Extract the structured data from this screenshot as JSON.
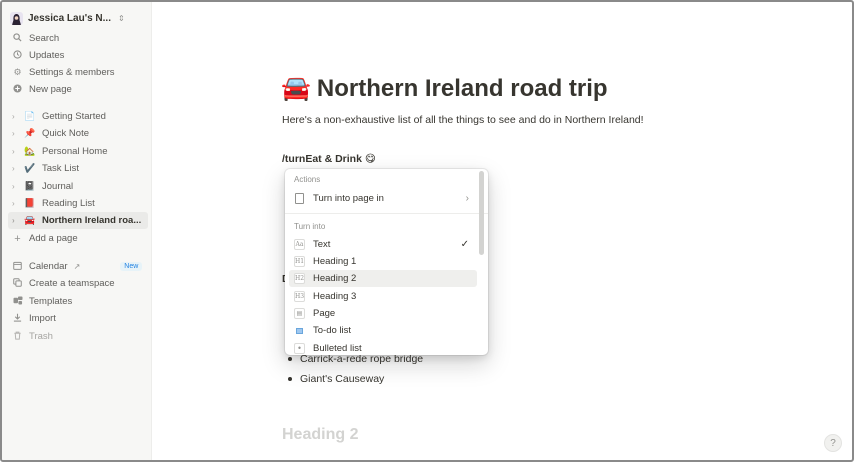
{
  "workspace": {
    "name": "Jessica Lau's N..."
  },
  "sidebar": {
    "top_items": [
      {
        "label": "Search",
        "icon": "search-icon"
      },
      {
        "label": "Updates",
        "icon": "clock-icon"
      },
      {
        "label": "Settings & members",
        "icon": "gear-icon"
      },
      {
        "label": "New page",
        "icon": "plus-circle-icon"
      }
    ],
    "pages": [
      {
        "emoji": "📄",
        "label": "Getting Started"
      },
      {
        "emoji": "📌",
        "label": "Quick Note"
      },
      {
        "emoji": "🏡",
        "label": "Personal Home"
      },
      {
        "emoji": "✔️",
        "label": "Task List"
      },
      {
        "emoji": "📓",
        "label": "Journal"
      },
      {
        "emoji": "📕",
        "label": "Reading List"
      },
      {
        "emoji": "🚘",
        "label": "Northern Ireland roa..."
      }
    ],
    "add_page": "Add a page",
    "bottom_items": [
      {
        "label": "Calendar",
        "icon": "calendar-icon",
        "badge": "New"
      },
      {
        "label": "Create a teamspace",
        "icon": "teamspace-icon"
      },
      {
        "label": "Templates",
        "icon": "templates-icon"
      },
      {
        "label": "Import",
        "icon": "download-icon"
      },
      {
        "label": "Trash",
        "icon": "trash-icon"
      }
    ]
  },
  "page": {
    "emoji": "🚘",
    "title": "Northern Ireland road trip",
    "intro": "Here's a non-exhaustive list of all the things to see and do in Northern Ireland!",
    "typed_line": "/turnEat & Drink 😋",
    "partial_letter": "D",
    "bullets": [
      "Carrick-a-rede rope bridge",
      "Giant's Causeway"
    ],
    "faded_heading": "Heading 2",
    "help_label": "?"
  },
  "menu": {
    "actions_title": "Actions",
    "action_item": "Turn into page in",
    "turn_into_title": "Turn into",
    "items": [
      {
        "label": "Text",
        "icon": "Aa",
        "checked": true
      },
      {
        "label": "Heading 1",
        "icon": "H1"
      },
      {
        "label": "Heading 2",
        "icon": "H2",
        "highlighted": true
      },
      {
        "label": "Heading 3",
        "icon": "H3"
      },
      {
        "label": "Page",
        "icon": "page-icon"
      },
      {
        "label": "To-do list",
        "icon": "todo-icon"
      },
      {
        "label": "Bulleted list",
        "icon": "bullet-icon"
      }
    ]
  }
}
